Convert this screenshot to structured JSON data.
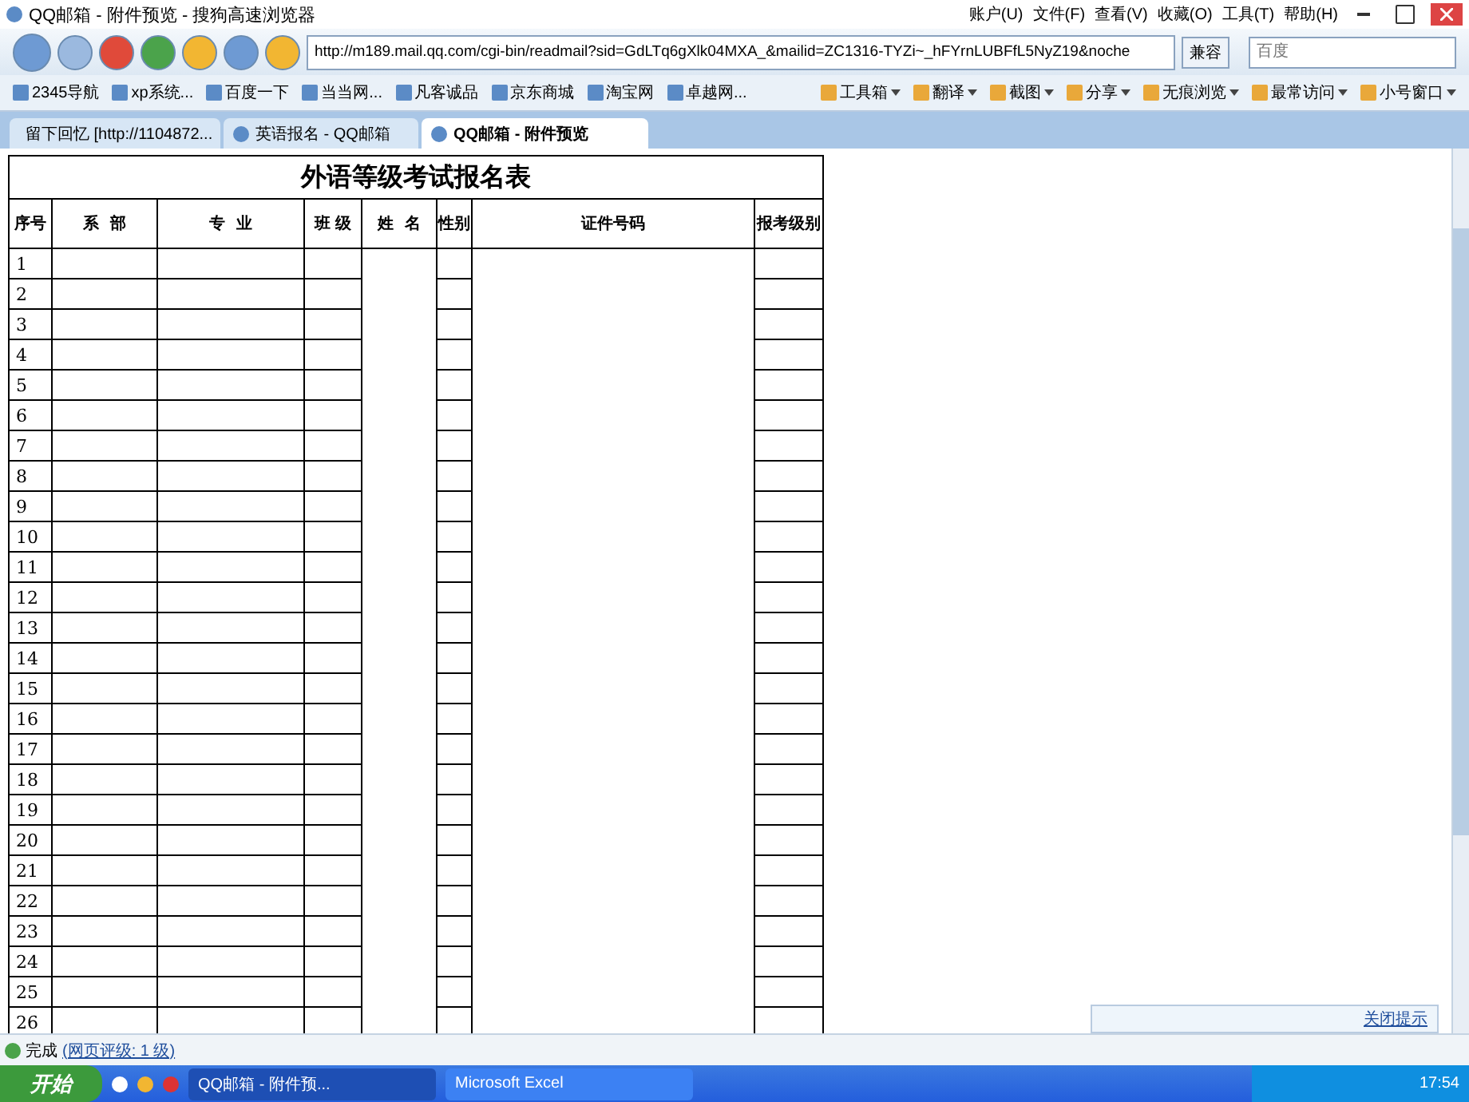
{
  "window": {
    "title": "QQ邮箱 - 附件预览 - 搜狗高速浏览器"
  },
  "menu": [
    "账户(U)",
    "文件(F)",
    "查看(V)",
    "收藏(O)",
    "工具(T)",
    "帮助(H)"
  ],
  "address": {
    "value": "http://m189.mail.qq.com/cgi-bin/readmail?sid=GdLTq6gXlk04MXA_&mailid=ZC1316-TYZi~_hFYrnLUBFfL5NyZ19&noche",
    "mode": "兼容"
  },
  "search": {
    "placeholder": "百度"
  },
  "favorites": [
    "2345导航",
    "xp系统...",
    "百度一下",
    "当当网...",
    "凡客诚品",
    "京东商城",
    "淘宝网",
    "卓越网..."
  ],
  "tools": [
    "工具箱",
    "翻译",
    "截图",
    "分享",
    "无痕浏览",
    "最常访问",
    "小号窗口"
  ],
  "tabs": [
    {
      "label": "留下回忆 [http://1104872...",
      "selected": false
    },
    {
      "label": "英语报名 - QQ邮箱",
      "selected": false
    },
    {
      "label": "QQ邮箱 - 附件预览",
      "selected": true
    }
  ],
  "sheet": {
    "title": "外语等级考试报名表",
    "columns": [
      "序号",
      "系  部",
      "专  业",
      "班 级",
      "姓  名",
      "性别",
      "证件号码",
      "报考级别"
    ],
    "rows": [
      "1",
      "2",
      "3",
      "4",
      "5",
      "6",
      "7",
      "8",
      "9",
      "10",
      "11",
      "12",
      "13",
      "14",
      "15",
      "16",
      "17",
      "18",
      "19",
      "20",
      "21",
      "22",
      "23",
      "24",
      "25",
      "26"
    ]
  },
  "notice": {
    "link": "关闭提示"
  },
  "status_bar": {
    "text": "完成",
    "rating": "(网页评级: 1 级)"
  },
  "taskbar": {
    "start": "开始",
    "tasks": [
      {
        "label": "QQ邮箱 - 附件预...",
        "selected": true
      },
      {
        "label": "Microsoft Excel",
        "selected": false
      }
    ],
    "clock": "17:54"
  }
}
